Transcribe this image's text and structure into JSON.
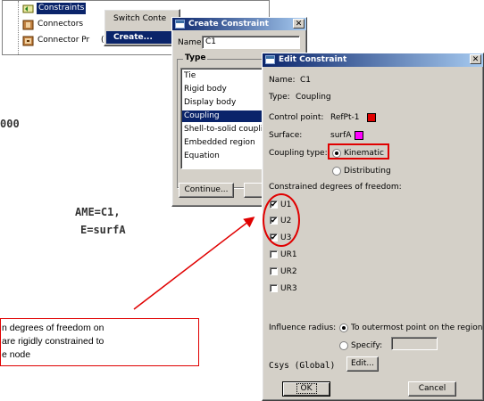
{
  "tree": {
    "items": [
      {
        "label": "Constraints"
      },
      {
        "label": "Connectors"
      },
      {
        "label": "Connector Pr"
      }
    ],
    "partial_text": "(   )"
  },
  "context_menu": {
    "items": [
      {
        "label": "Switch Conte"
      },
      {
        "label": "Create..."
      }
    ]
  },
  "code_fragments": {
    "line1": "000",
    "line2": "AME=C1,",
    "line3": "E=surfA"
  },
  "callout": {
    "text_line1": "n degrees of freedom on",
    "text_line2": "are rigidly constrained to",
    "text_line3": "e node"
  },
  "create_dialog": {
    "title": "Create Constraint",
    "name_label": "Name:",
    "name_value": "C1",
    "type_group": "Type",
    "types": [
      "Tie",
      "Rigid body",
      "Display body",
      "Coupling",
      "Shell-to-solid couplin",
      "Embedded region",
      "Equation"
    ],
    "selected_type": "Coupling",
    "continue_label": "Continue...",
    "cancel_partial": "C"
  },
  "edit_dialog": {
    "title": "Edit Constraint",
    "name_label": "Name:",
    "name_value": "C1",
    "type_label": "Type:",
    "type_value": "Coupling",
    "control_point_label": "Control point:",
    "control_point_value": "RefPt-1",
    "control_point_color": "#e00000",
    "surface_label": "Surface:",
    "surface_value": "surfA",
    "surface_color": "#ff00ff",
    "coupling_type_label": "Coupling type:",
    "coupling_options": [
      {
        "label": "Kinematic",
        "selected": true
      },
      {
        "label": "Distributing",
        "selected": false
      }
    ],
    "dof_label": "Constrained degrees of freedom:",
    "dofs": [
      {
        "label": "U1",
        "checked": true
      },
      {
        "label": "U2",
        "checked": true
      },
      {
        "label": "U3",
        "checked": true
      },
      {
        "label": "UR1",
        "checked": false
      },
      {
        "label": "UR2",
        "checked": false
      },
      {
        "label": "UR3",
        "checked": false
      }
    ],
    "influence_label": "Influence radius:",
    "influence_options": [
      {
        "label": "To outermost point on the region",
        "selected": true
      },
      {
        "label": "Specify:",
        "selected": false
      }
    ],
    "csys_label": "Csys (Global)",
    "edit_label": "Edit...",
    "ok_label": "OK",
    "cancel_label": "Cancel"
  },
  "colors": {
    "highlight": "#e00000",
    "selection": "#0a246a"
  }
}
